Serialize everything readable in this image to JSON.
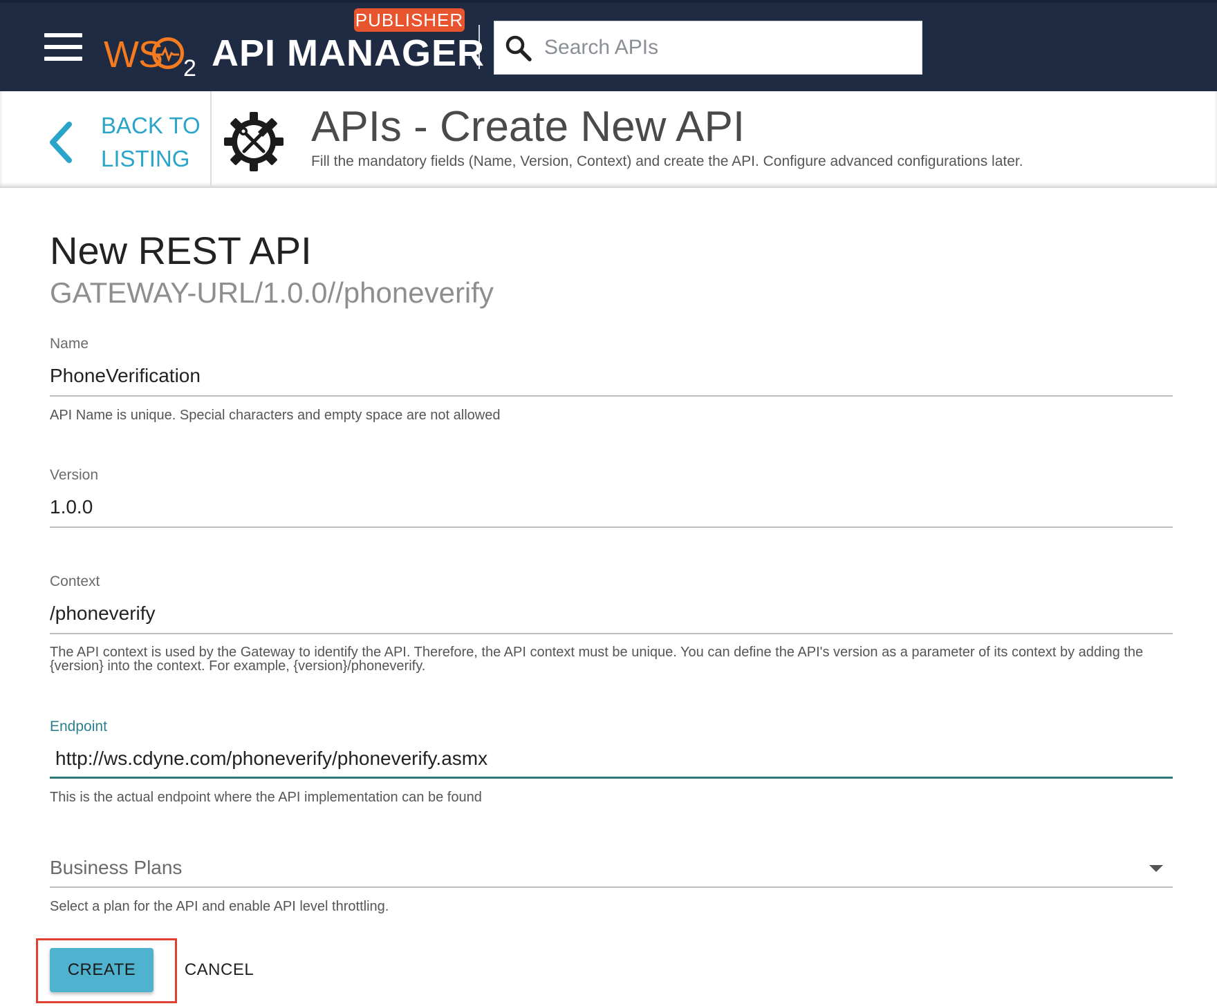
{
  "topbar": {
    "brand_ws": "WS",
    "brand_2": "2",
    "brand_name": "API MANAGER",
    "badge": "PUBLISHER",
    "search_placeholder": "Search APIs",
    "bg_color": "#1f2b42",
    "badge_color": "#e8542d",
    "icons": [
      "hamburger-menu-icon",
      "search-icon"
    ]
  },
  "header": {
    "back_line1": "BACK TO",
    "back_line2": "LISTING",
    "title": "APIs - Create New API",
    "description": "Fill the mandatory fields (Name, Version, Context) and create the API. Configure advanced configurations later.",
    "icons": [
      "chevron-left-icon",
      "gear-tools-icon"
    ]
  },
  "form": {
    "title": "New REST API",
    "url_preview": "GATEWAY-URL/1.0.0//phoneverify",
    "name": {
      "label": "Name",
      "value": "PhoneVerification",
      "helper": "API Name is unique. Special characters and empty space are not allowed"
    },
    "version": {
      "label": "Version",
      "value": "1.0.0"
    },
    "context": {
      "label": "Context",
      "value": "/phoneverify",
      "helper": "The API context is used by the Gateway to identify the API. Therefore, the API context must be unique. You can define the API's version as a parameter of its context by adding the {version} into the context. For example, {version}/phoneverify."
    },
    "endpoint": {
      "label": "Endpoint",
      "value": "http://ws.cdyne.com/phoneverify/phoneverify.asmx",
      "helper": "This is the actual endpoint where the API implementation can be found"
    },
    "business_plans": {
      "label": "Business Plans",
      "helper": "Select a plan for the API and enable API level throttling."
    },
    "actions": {
      "create": "CREATE",
      "cancel": "CANCEL"
    },
    "accent_color": "#2e7c7a",
    "button_color": "#4fb3cf",
    "highlight_color": "#e0402f"
  }
}
